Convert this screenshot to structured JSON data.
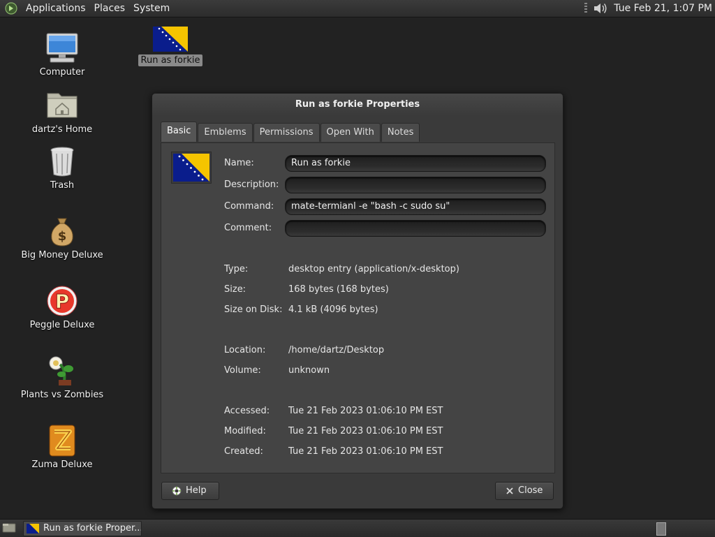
{
  "top_panel": {
    "menus": [
      "Applications",
      "Places",
      "System"
    ],
    "clock": "Tue Feb 21,  1:07 PM",
    "icons": [
      "mate-menu-icon",
      "volume-icon"
    ]
  },
  "desktop": {
    "icons": [
      {
        "label": "Computer",
        "icon": "computer-icon"
      },
      {
        "label": "dartz's Home",
        "icon": "home-folder-icon"
      },
      {
        "label": "Trash",
        "icon": "trash-icon"
      },
      {
        "label": "Big Money Deluxe",
        "icon": "money-bag-icon"
      },
      {
        "label": "Peggle Deluxe",
        "icon": "peggle-icon"
      },
      {
        "label": "Plants vs Zombies",
        "icon": "plants-vs-zombies-icon"
      },
      {
        "label": "Zuma Deluxe",
        "icon": "zuma-icon"
      }
    ],
    "selected_icon": {
      "label": "Run as forkie",
      "icon": "bosnia-flag-icon"
    }
  },
  "dialog": {
    "title": "Run as forkie Properties",
    "tabs": [
      "Basic",
      "Emblems",
      "Permissions",
      "Open With",
      "Notes"
    ],
    "active_tab": "Basic",
    "fields": {
      "name": {
        "label": "Name:",
        "value": "Run as forkie"
      },
      "description": {
        "label": "Description:",
        "value": ""
      },
      "command": {
        "label": "Command:",
        "value": "mate-termianl -e \"bash -c sudo su\""
      },
      "comment": {
        "label": "Comment:",
        "value": ""
      }
    },
    "info": {
      "type": {
        "label": "Type:",
        "value": "desktop entry (application/x-desktop)"
      },
      "size": {
        "label": "Size:",
        "value": "168 bytes (168 bytes)"
      },
      "size_on_disk": {
        "label": "Size on Disk:",
        "value": "4.1 kB (4096 bytes)"
      },
      "location": {
        "label": "Location:",
        "value": "/home/dartz/Desktop"
      },
      "volume": {
        "label": "Volume:",
        "value": "unknown"
      },
      "accessed": {
        "label": "Accessed:",
        "value": "Tue 21 Feb 2023 01:06:10 PM EST"
      },
      "modified": {
        "label": "Modified:",
        "value": "Tue 21 Feb 2023 01:06:10 PM EST"
      },
      "created": {
        "label": "Created:",
        "value": "Tue 21 Feb 2023 01:06:10 PM EST"
      }
    },
    "buttons": {
      "help": "Help",
      "close": "Close"
    }
  },
  "bottom_panel": {
    "task_label": "Run as forkie Proper..."
  },
  "colors": {
    "desktop_bg": "#222222",
    "dialog_bg": "#3a3a3a",
    "flag_blue": "#0a1d8c",
    "flag_yellow": "#f5c400"
  }
}
